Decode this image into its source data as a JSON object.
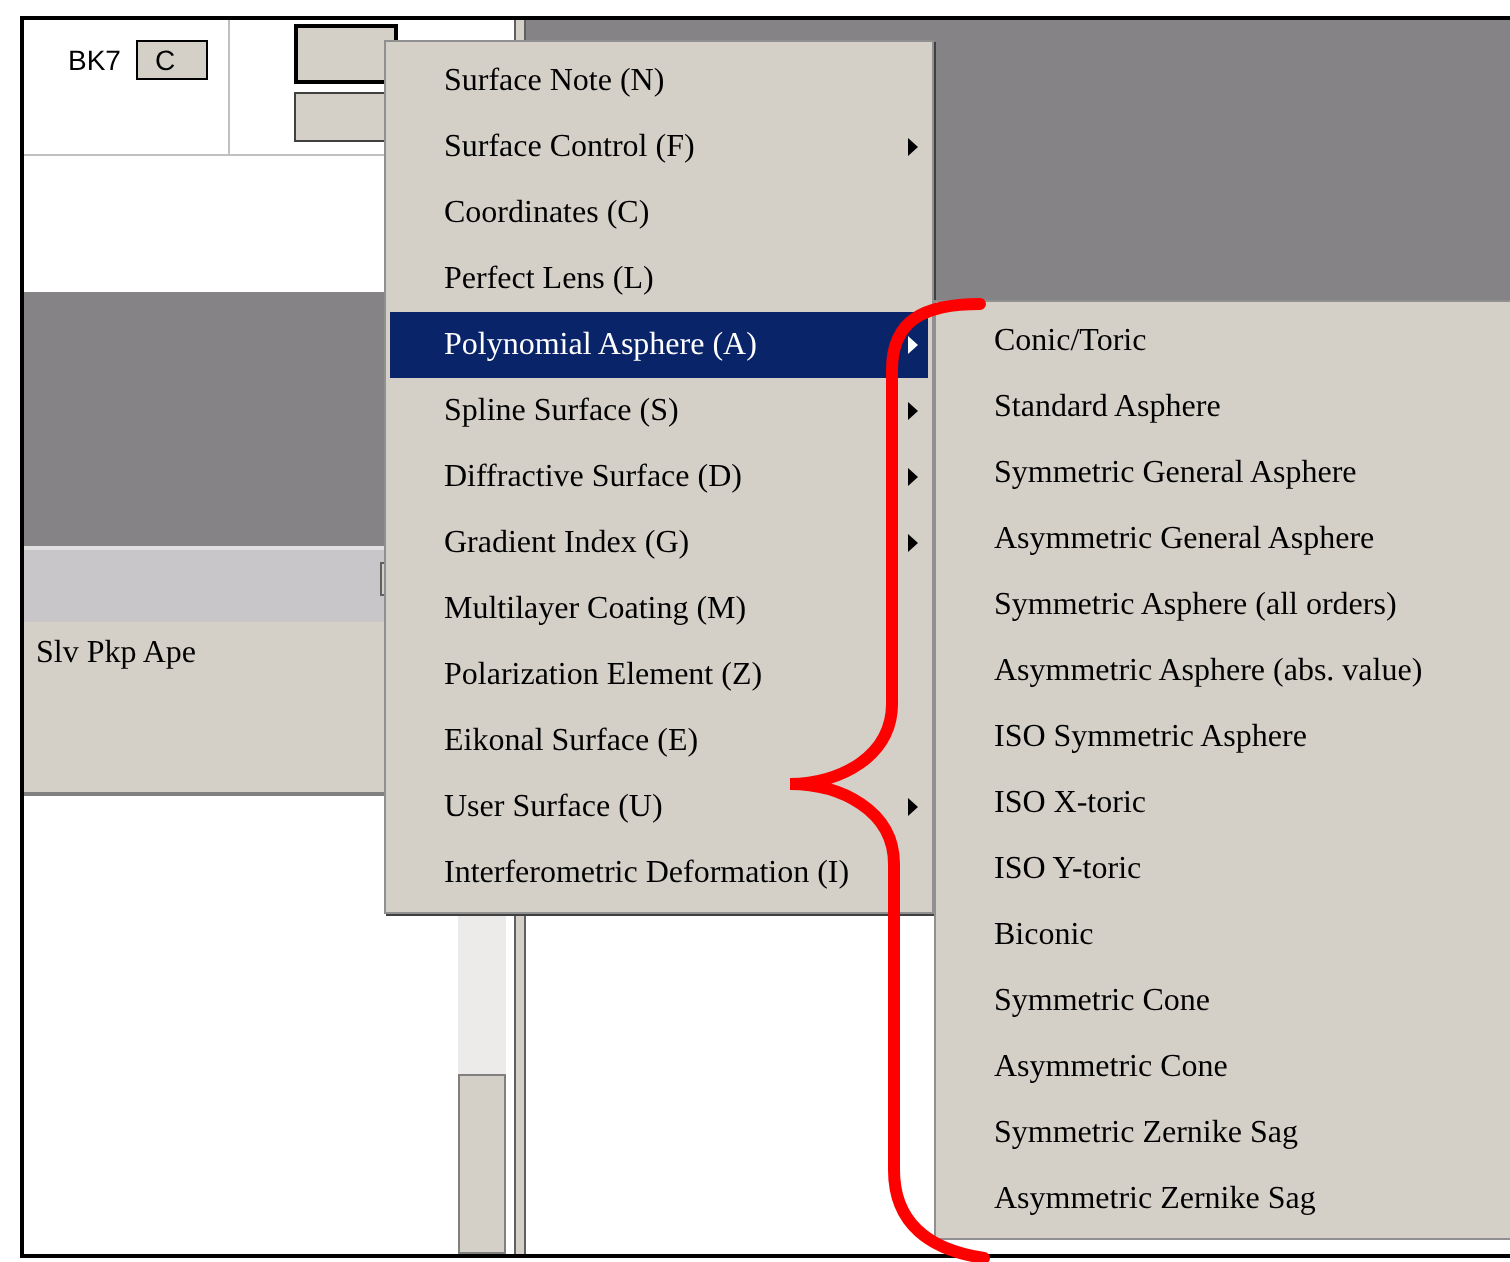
{
  "editor": {
    "glass_label": "BK7",
    "glass_button": "C",
    "column_headers": "Slv Pkp Ape"
  },
  "menu": {
    "items": [
      {
        "label": "Surface Note (N)",
        "submenu": false,
        "selected": false
      },
      {
        "label": "Surface Control (F)",
        "submenu": true,
        "selected": false
      },
      {
        "label": "Coordinates (C)",
        "submenu": false,
        "selected": false
      },
      {
        "label": "Perfect Lens (L)",
        "submenu": false,
        "selected": false
      },
      {
        "label": "Polynomial Asphere (A)",
        "submenu": true,
        "selected": true
      },
      {
        "label": "Spline Surface (S)",
        "submenu": true,
        "selected": false
      },
      {
        "label": "Diffractive Surface (D)",
        "submenu": true,
        "selected": false
      },
      {
        "label": "Gradient Index (G)",
        "submenu": true,
        "selected": false
      },
      {
        "label": "Multilayer Coating (M)",
        "submenu": false,
        "selected": false
      },
      {
        "label": "Polarization Element (Z)",
        "submenu": false,
        "selected": false
      },
      {
        "label": "Eikonal Surface (E)",
        "submenu": false,
        "selected": false
      },
      {
        "label": "User Surface (U)",
        "submenu": true,
        "selected": false
      },
      {
        "label": "Interferometric Deformation (I)",
        "submenu": false,
        "selected": false
      }
    ]
  },
  "submenu": {
    "items": [
      {
        "label": "Conic/Toric"
      },
      {
        "label": "Standard Asphere"
      },
      {
        "label": "Symmetric General Asphere"
      },
      {
        "label": "Asymmetric General Asphere"
      },
      {
        "label": "Symmetric Asphere (all orders)"
      },
      {
        "label": "Asymmetric Asphere (abs. value)"
      },
      {
        "label": "ISO Symmetric Asphere"
      },
      {
        "label": "ISO X-toric"
      },
      {
        "label": "ISO Y-toric"
      },
      {
        "label": "Biconic"
      },
      {
        "label": "Symmetric Cone"
      },
      {
        "label": "Asymmetric Cone"
      },
      {
        "label": "Symmetric Zernike Sag"
      },
      {
        "label": "Asymmetric Zernike Sag"
      }
    ]
  }
}
